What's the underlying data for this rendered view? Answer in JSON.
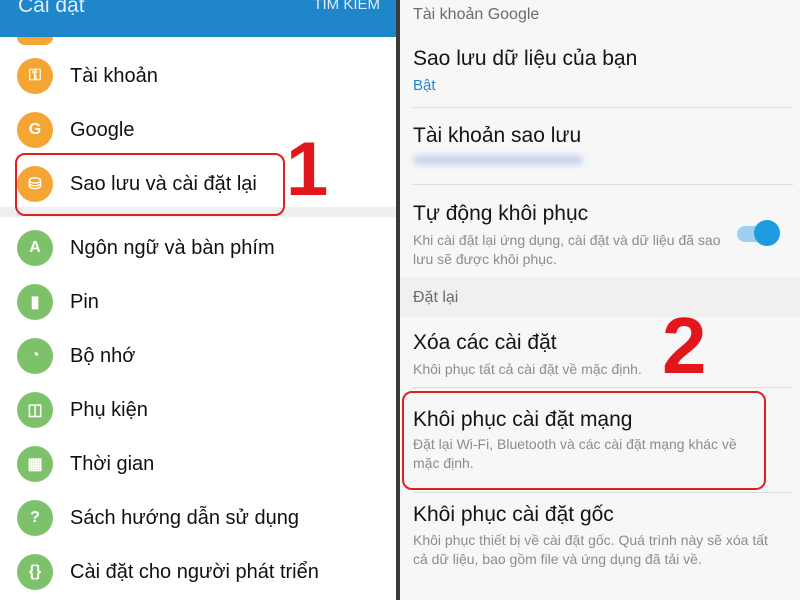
{
  "left": {
    "appbar": {
      "title": "Cài đặt",
      "search": "TÌM KIẾM"
    },
    "items": [
      {
        "label": "Tài khoản",
        "icon": "key-icon",
        "glyph": "⚿",
        "color": "#f4a533"
      },
      {
        "label": "Google",
        "icon": "google-icon",
        "glyph": "G",
        "color": "#f4a533"
      },
      {
        "label": "Sao lưu và cài đặt lại",
        "icon": "backup-restore-icon",
        "glyph": "⛁",
        "color": "#f4a533"
      },
      {
        "label": "Ngôn ngữ và bàn phím",
        "icon": "language-icon",
        "glyph": "A",
        "color": "#7dc16a"
      },
      {
        "label": "Pin",
        "icon": "battery-icon",
        "glyph": "▮",
        "color": "#7dc16a"
      },
      {
        "label": "Bộ nhớ",
        "icon": "storage-icon",
        "glyph": "◔",
        "color": "#7dc16a"
      },
      {
        "label": "Phụ kiện",
        "icon": "accessory-icon",
        "glyph": "◫",
        "color": "#7dc16a"
      },
      {
        "label": "Thời gian",
        "icon": "calendar-icon",
        "glyph": "▦",
        "color": "#7dc16a"
      },
      {
        "label": "Sách hướng dẫn sử dụng",
        "icon": "manual-icon",
        "glyph": "?",
        "color": "#7dc16a"
      },
      {
        "label": "Cài đặt cho người phát triển",
        "icon": "developer-icon",
        "glyph": "{}",
        "color": "#7dc16a"
      }
    ],
    "step": "1"
  },
  "right": {
    "section_google": "Tài khoản Google",
    "backup": {
      "title": "Sao lưu dữ liệu của bạn",
      "status": "Bật",
      "status_color": "#1e88d2"
    },
    "backup_account": {
      "title": "Tài khoản sao lưu"
    },
    "auto_restore": {
      "title": "Tự động khôi phục",
      "desc": "Khi cài đặt lại ứng dụng, cài đặt và dữ liệu đã sao lưu sẽ được khôi phục.",
      "enabled": true
    },
    "section_reset": "Đặt lại",
    "reset_settings": {
      "title": "Xóa các cài đặt",
      "desc": "Khôi phục tất cả cài đặt về mặc định."
    },
    "reset_network": {
      "title": "Khôi phục cài đặt mạng",
      "desc": "Đặt lại Wi-Fi, Bluetooth và các cài đặt mạng khác về mặc định."
    },
    "factory_reset": {
      "title": "Khôi phục cài đặt gốc",
      "desc": "Khôi phục thiết bị về cài đặt gốc. Quá trình này sẽ xóa tất cả dữ liệu, bao gồm file và ứng dụng đã tải về."
    },
    "step": "2"
  }
}
